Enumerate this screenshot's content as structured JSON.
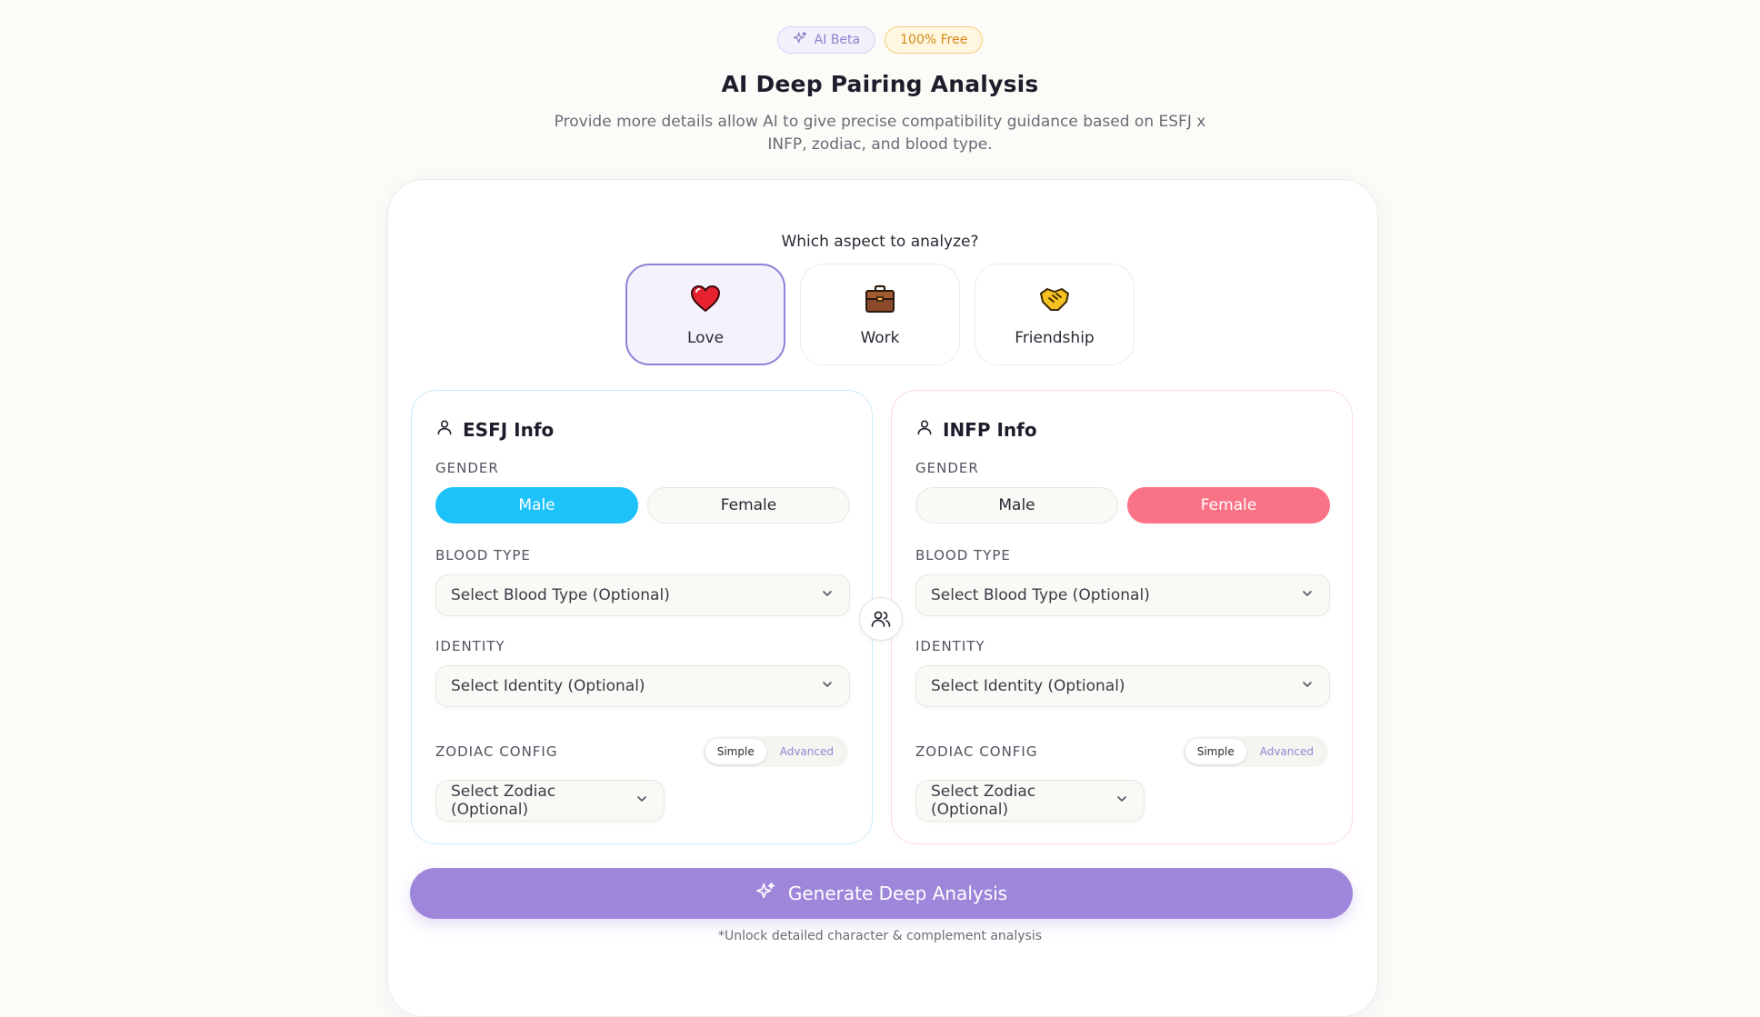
{
  "header": {
    "badge_ai": "AI Beta",
    "badge_free": "100% Free",
    "title": "AI Deep Pairing Analysis",
    "subtitle": "Provide more details allow AI to give precise compatibility guidance based on ESFJ x INFP, zodiac, and blood type."
  },
  "aspects": {
    "question": "Which aspect to analyze?",
    "items": [
      {
        "label": "Love",
        "icon": "heart-icon",
        "selected": true
      },
      {
        "label": "Work",
        "icon": "briefcase-icon",
        "selected": false
      },
      {
        "label": "Friendship",
        "icon": "handshake-icon",
        "selected": false
      }
    ]
  },
  "left": {
    "title": "ESFJ Info",
    "gender_label": "GENDER",
    "male": "Male",
    "female": "Female",
    "selected_gender": "Male",
    "blood_label": "BLOOD TYPE",
    "blood_placeholder": "Select Blood Type (Optional)",
    "identity_label": "IDENTITY",
    "identity_placeholder": "Select Identity (Optional)",
    "zodiac_label": "ZODIAC CONFIG",
    "simple": "Simple",
    "advanced": "Advanced",
    "zodiac_placeholder": "Select Zodiac (Optional)"
  },
  "right": {
    "title": "INFP Info",
    "gender_label": "GENDER",
    "male": "Male",
    "female": "Female",
    "selected_gender": "Female",
    "blood_label": "BLOOD TYPE",
    "blood_placeholder": "Select Blood Type (Optional)",
    "identity_label": "IDENTITY",
    "identity_placeholder": "Select Identity (Optional)",
    "zodiac_label": "ZODIAC CONFIG",
    "simple": "Simple",
    "advanced": "Advanced",
    "zodiac_placeholder": "Select Zodiac (Optional)"
  },
  "actions": {
    "generate": "Generate Deep Analysis",
    "footnote": "*Unlock detailed character & complement analysis"
  },
  "colors": {
    "accent_purple": "#9e87db",
    "male_blue": "#1ec2fb",
    "female_pink": "#fa7285",
    "free_orange": "#d38a12"
  }
}
